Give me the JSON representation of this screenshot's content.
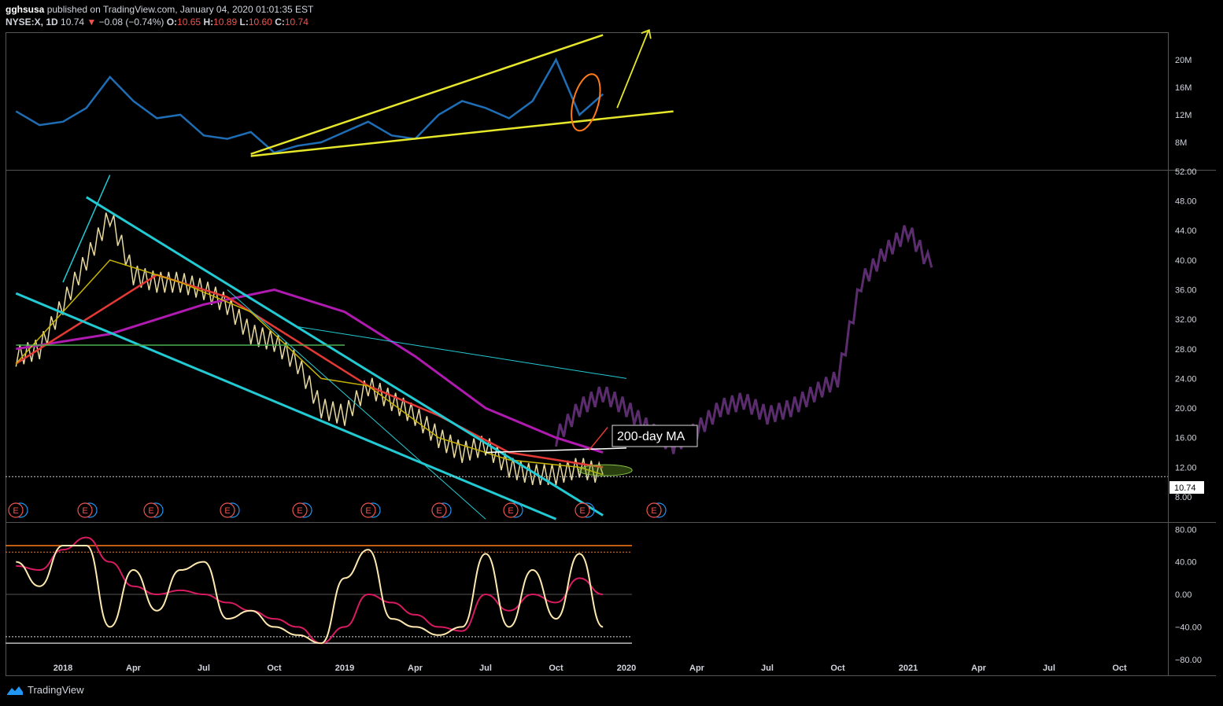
{
  "header": {
    "publisher": "gghsusa",
    "published_text": "published on TradingView.com, January 04, 2020 01:01:35 EST",
    "symbol": "NYSE:X, 1D",
    "last": "10.74",
    "change_arrow": "▼",
    "change": "−0.08 (−0.74%)",
    "o_label": "O:",
    "o_val": "10.65",
    "h_label": "H:",
    "h_val": "10.89",
    "l_label": "L:",
    "l_val": "10.60",
    "c_label": "C:",
    "c_val": "10.74"
  },
  "footer": {
    "brand": "TradingView"
  },
  "annotation": {
    "text": "200-day MA"
  },
  "price_label": "10.74",
  "colors": {
    "background": "#000000",
    "volume_line": "#1e6db5",
    "yellow": "#e6e62a",
    "cyan": "#22cbd4",
    "magenta": "#b01ab0",
    "red": "#e53935",
    "orange": "#ff7a1a",
    "green": "#4caf50",
    "purple_projection": "#5c2d6e"
  },
  "chart_data": [
    {
      "type": "line",
      "panel": "volume",
      "y_ticks": [
        "20M",
        "16M",
        "12M",
        "8M"
      ],
      "y_values": [
        20,
        16,
        12,
        8
      ],
      "unit": "M",
      "series": [
        {
          "x": [
            "2017-11",
            "2017-12",
            "2018-01",
            "2018-02",
            "2018-03",
            "2018-04",
            "2018-05",
            "2018-06",
            "2018-07",
            "2018-08",
            "2018-09",
            "2018-10",
            "2018-11",
            "2018-12",
            "2019-01",
            "2019-02",
            "2019-03",
            "2019-04",
            "2019-05",
            "2019-06",
            "2019-07",
            "2019-08",
            "2019-09",
            "2019-10",
            "2019-11",
            "2019-12"
          ],
          "values": [
            12.5,
            10.5,
            11,
            13,
            17.5,
            14,
            11.5,
            12,
            9,
            8.5,
            9.5,
            6.5,
            7.5,
            8,
            9.5,
            11,
            9,
            8.5,
            12,
            14,
            13,
            11.5,
            14,
            20,
            12,
            15
          ]
        }
      ]
    },
    {
      "type": "line",
      "panel": "price",
      "y_ticks": [
        "52.00",
        "48.00",
        "44.00",
        "40.00",
        "36.00",
        "32.00",
        "28.00",
        "24.00",
        "20.00",
        "16.00",
        "12.00",
        "8.00"
      ],
      "y_values": [
        52,
        48,
        44,
        40,
        36,
        32,
        28,
        24,
        20,
        16,
        12,
        8
      ],
      "last_price": 10.74,
      "series": [
        {
          "x": [
            "2017-11",
            "2017-12",
            "2018-01",
            "2018-02",
            "2018-03",
            "2018-04",
            "2018-05",
            "2018-06",
            "2018-07",
            "2018-08",
            "2018-09",
            "2018-10",
            "2018-11",
            "2018-12",
            "2019-01",
            "2019-02",
            "2019-03",
            "2019-04",
            "2019-05",
            "2019-06",
            "2019-07",
            "2019-08",
            "2019-09",
            "2019-10",
            "2019-11",
            "2019-12"
          ],
          "values": [
            27,
            28,
            34,
            40,
            46,
            38,
            37,
            37,
            36,
            34,
            30,
            29,
            26,
            20,
            19,
            23,
            21,
            19,
            16,
            14,
            15,
            12,
            11,
            11,
            12,
            11
          ]
        },
        {
          "x": [
            "2019-10",
            "2019-11",
            "2019-12",
            "2020-01",
            "2020-02",
            "2020-03",
            "2020-04",
            "2020-05",
            "2020-06",
            "2020-07",
            "2020-08",
            "2020-09",
            "2020-10",
            "2020-11",
            "2020-12",
            "2021-01",
            "2021-02"
          ],
          "values": [
            16,
            20,
            22,
            20,
            17,
            15,
            17,
            20,
            21,
            19,
            20,
            22,
            24,
            37,
            41,
            44,
            39
          ]
        }
      ]
    },
    {
      "type": "line",
      "panel": "oscillator",
      "y_ticks": [
        "80.00",
        "40.00",
        "0.00",
        "−40.00",
        "−80.00"
      ],
      "y_values": [
        80,
        40,
        0,
        -40,
        -80
      ],
      "series": [
        {
          "x": [
            "2017-11",
            "2017-12",
            "2018-01",
            "2018-02",
            "2018-03",
            "2018-04",
            "2018-05",
            "2018-06",
            "2018-07",
            "2018-08",
            "2018-09",
            "2018-10",
            "2018-11",
            "2018-12",
            "2019-01",
            "2019-02",
            "2019-03",
            "2019-04",
            "2019-05",
            "2019-06",
            "2019-07",
            "2019-08",
            "2019-09",
            "2019-10",
            "2019-11",
            "2019-12"
          ],
          "values": [
            40,
            10,
            60,
            60,
            -40,
            30,
            -20,
            30,
            40,
            -30,
            -20,
            -40,
            -50,
            -60,
            20,
            55,
            -30,
            -40,
            -50,
            -40,
            50,
            -40,
            30,
            -30,
            50,
            -40
          ]
        },
        {
          "x": [
            "2017-11",
            "2017-12",
            "2018-01",
            "2018-02",
            "2018-03",
            "2018-04",
            "2018-05",
            "2018-06",
            "2018-07",
            "2018-08",
            "2018-09",
            "2018-10",
            "2018-11",
            "2018-12",
            "2019-01",
            "2019-02",
            "2019-03",
            "2019-04",
            "2019-05",
            "2019-06",
            "2019-07",
            "2019-08",
            "2019-09",
            "2019-10",
            "2019-11",
            "2019-12"
          ],
          "values": [
            35,
            30,
            55,
            70,
            40,
            10,
            0,
            5,
            0,
            -10,
            -20,
            -30,
            -40,
            -60,
            -40,
            0,
            -10,
            -25,
            -40,
            -45,
            0,
            -20,
            0,
            -10,
            20,
            0
          ]
        }
      ]
    }
  ],
  "x_axis": {
    "labels": [
      "2018",
      "Apr",
      "Jul",
      "Oct",
      "2019",
      "Apr",
      "Jul",
      "Oct",
      "2020",
      "Apr",
      "Jul",
      "Oct",
      "2021",
      "Apr",
      "Jul",
      "Oct"
    ]
  },
  "earnings_markers": [
    "E",
    "E",
    "E",
    "E",
    "E",
    "E",
    "E",
    "E",
    "E",
    "E"
  ]
}
